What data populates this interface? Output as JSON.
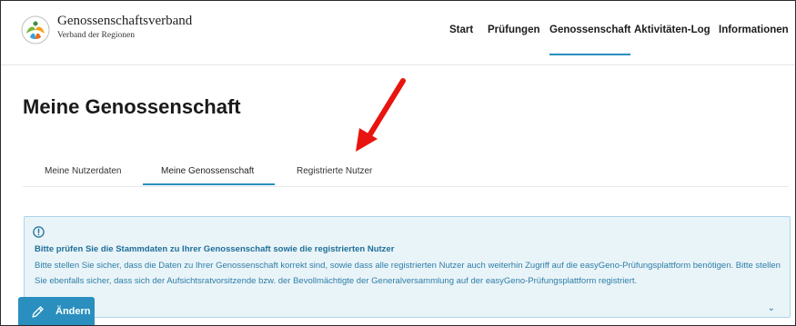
{
  "header": {
    "brand_name": "Genossenschaftsverband",
    "brand_subtitle": "Verband der Regionen",
    "nav": [
      {
        "label": "Start"
      },
      {
        "label": "Prüfungen"
      },
      {
        "label": "Genossenschaft",
        "active": true
      },
      {
        "label": "Aktivitäten-Log"
      },
      {
        "label": "Informationen"
      }
    ]
  },
  "page": {
    "title": "Meine Genossenschaft"
  },
  "tabs": [
    {
      "label": "Meine Nutzerdaten"
    },
    {
      "label": "Meine Genossenschaft",
      "active": true
    },
    {
      "label": "Registrierte Nutzer"
    }
  ],
  "info": {
    "icon": "exclamation-circle-icon",
    "heading": "Bitte prüfen Sie die Stammdaten zu Ihrer Genossenschaft sowie die registrierten Nutzer",
    "text": "Bitte stellen Sie sicher, dass die Daten zu Ihrer Genossenschaft korrekt sind, sowie dass alle registrierten Nutzer auch weiterhin Zugriff auf die easyGeno-Prüfungsplattform benötigen. Bitte stellen Sie ebenfalls sicher, dass sich der Aufsichtsratvorsitzende bzw. der Bevollmächtigte der Generalversammlung auf der easyGeno-Prüfungsplattform registriert."
  },
  "actions": {
    "edit_label": "Ändern",
    "edit_icon": "pencil-icon"
  },
  "colors": {
    "accent": "#2a8fbf",
    "info_bg": "#e9f4f9",
    "info_text": "#2f7ea6",
    "annotation_arrow": "#e8140f"
  }
}
